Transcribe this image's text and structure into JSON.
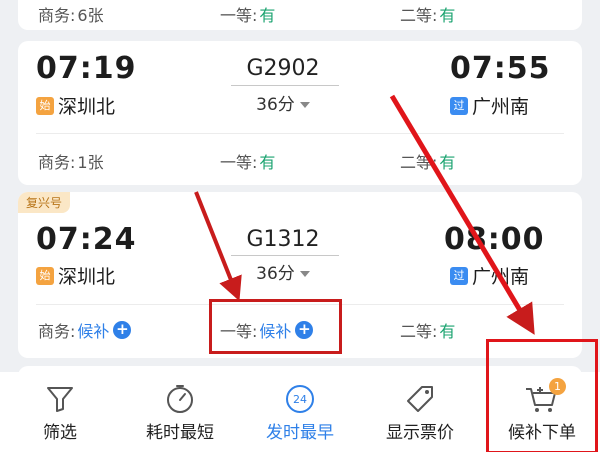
{
  "top_card": {
    "seats": [
      {
        "label": "商务:",
        "value": "6张"
      },
      {
        "label": "一等:",
        "value": "有"
      },
      {
        "label": "二等:",
        "value": "有"
      }
    ]
  },
  "trains": [
    {
      "tag": "",
      "dep_time": "07:19",
      "train_no": "G2902",
      "duration": "36分",
      "arr_time": "07:55",
      "dep_badge": "始",
      "dep_station": "深圳北",
      "arr_badge": "过",
      "arr_station": "广州南",
      "seats": [
        {
          "label": "商务:",
          "value": "1张"
        },
        {
          "label": "一等:",
          "value": "有"
        },
        {
          "label": "二等:",
          "value": "有"
        }
      ]
    },
    {
      "tag": "复兴号",
      "dep_time": "07:24",
      "train_no": "G1312",
      "duration": "36分",
      "arr_time": "08:00",
      "dep_badge": "始",
      "dep_station": "深圳北",
      "arr_badge": "过",
      "arr_station": "广州南",
      "seats": [
        {
          "label": "商务:",
          "value": "候补"
        },
        {
          "label": "一等:",
          "value": "候补"
        },
        {
          "label": "二等:",
          "value": "有"
        }
      ]
    }
  ],
  "navbar": {
    "items": [
      {
        "label": "筛选",
        "icon": "filter-icon"
      },
      {
        "label": "耗时最短",
        "icon": "timer-icon"
      },
      {
        "label": "发时最早",
        "icon": "clock-24-icon",
        "badge_text": "24"
      },
      {
        "label": "显示票价",
        "icon": "price-tag-icon"
      },
      {
        "label": "候补下单",
        "icon": "cart-icon",
        "count": "1"
      }
    ]
  },
  "colors": {
    "accent_blue": "#2f80e8",
    "available_green": "#1aa36f",
    "annotation_red": "#c81c1c"
  }
}
